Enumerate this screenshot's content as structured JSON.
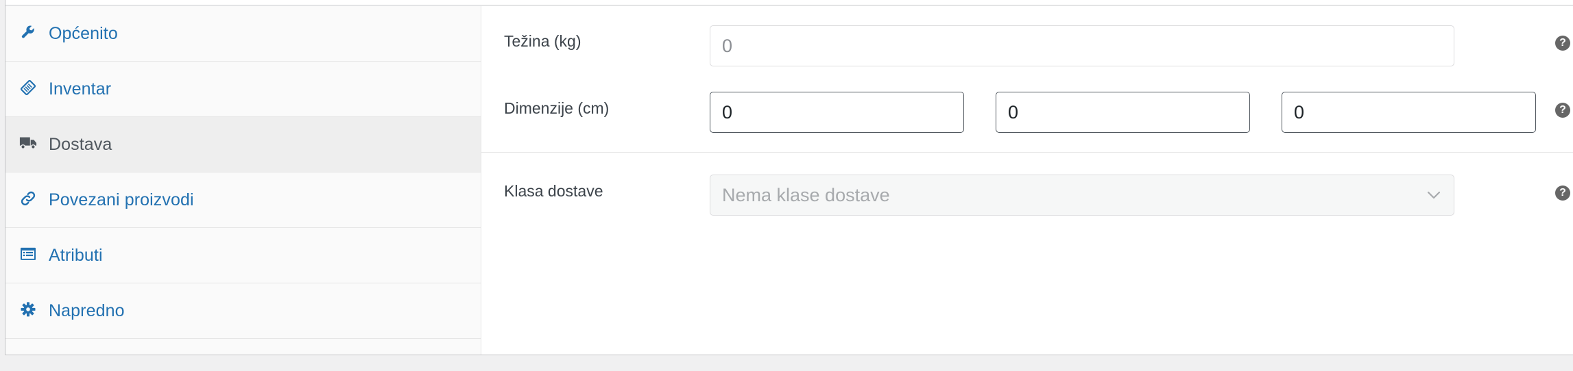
{
  "sidebar": {
    "items": [
      {
        "label": "Općenito",
        "icon": "wrench-icon",
        "active": false
      },
      {
        "label": "Inventar",
        "icon": "tag-icon",
        "active": false
      },
      {
        "label": "Dostava",
        "icon": "truck-icon",
        "active": true
      },
      {
        "label": "Povezani proizvodi",
        "icon": "link-icon",
        "active": false
      },
      {
        "label": "Atributi",
        "icon": "list-view-icon",
        "active": false
      },
      {
        "label": "Napredno",
        "icon": "gear-icon",
        "active": false
      }
    ]
  },
  "shipping": {
    "weight": {
      "label": "Težina (kg)",
      "value": "",
      "placeholder": "0"
    },
    "dimensions": {
      "label": "Dimenzije (cm)",
      "length": "0",
      "width": "0",
      "height": "0"
    },
    "shipping_class": {
      "label": "Klasa dostave",
      "selected": "Nema klase dostave"
    },
    "help_glyph": "?"
  },
  "colors": {
    "link": "#2271b1",
    "active_text": "#50575e",
    "active_bg": "#eeeeee",
    "sidebar_bg": "#fafafa"
  }
}
